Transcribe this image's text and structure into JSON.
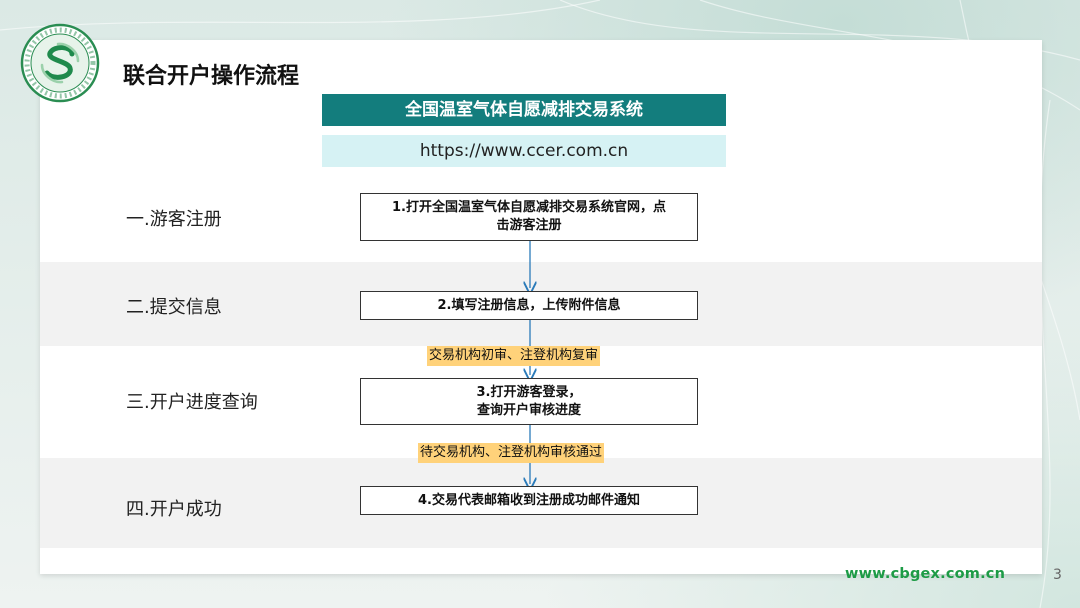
{
  "colors": {
    "accent_teal": "#137d7d",
    "url_box_bg": "#d6f2f4",
    "highlight": "#ffd27a",
    "footer_green": "#1d9b46"
  },
  "logo": {
    "icon": "ccbgex-round-logo"
  },
  "title": "联合开户操作流程",
  "system": {
    "name": "全国温室气体自愿减排交易系统",
    "url": "https://www.ccer.com.cn"
  },
  "stages": [
    {
      "label": "一.游客注册"
    },
    {
      "label": "二.提交信息"
    },
    {
      "label": "三.开户进度查询"
    },
    {
      "label": "四.开户成功"
    }
  ],
  "steps": [
    {
      "line1": "1.打开全国温室气体自愿减排交易系统官网，点",
      "line2": "击游客注册"
    },
    {
      "line1": "2.填写注册信息，上传附件信息"
    },
    {
      "line1": "3.打开游客登录，",
      "line2": "查询开户审核进度"
    },
    {
      "line1": "4.交易代表邮箱收到注册成功邮件通知"
    }
  ],
  "notes": [
    "交易机构初审、注登机构复审",
    "待交易机构、注登机构审核通过"
  ],
  "footer": {
    "url": "www.cbgex.com.cn",
    "page": "3"
  }
}
